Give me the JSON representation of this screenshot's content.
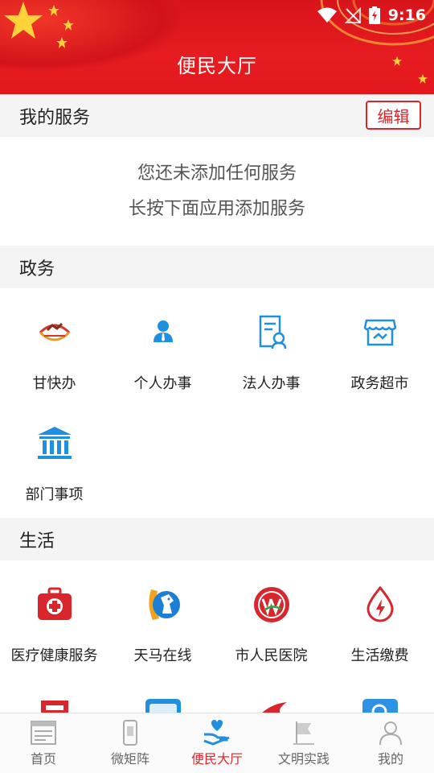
{
  "status_bar": {
    "time": "9:16",
    "icons": [
      "wifi-icon",
      "no-signal-icon",
      "battery-charging-icon"
    ]
  },
  "header": {
    "title": "便民大厅"
  },
  "my_services": {
    "title": "我的服务",
    "edit_label": "编辑",
    "empty_line1": "您还未添加任何服务",
    "empty_line2": "长按下面应用添加服务"
  },
  "government": {
    "title": "政务",
    "items": [
      {
        "label": "甘快办",
        "icon": "gankuaiban-logo-icon"
      },
      {
        "label": "个人办事",
        "icon": "person-icon"
      },
      {
        "label": "法人办事",
        "icon": "legal-person-document-icon"
      },
      {
        "label": "政务超市",
        "icon": "store-icon"
      },
      {
        "label": "部门事项",
        "icon": "government-building-icon"
      }
    ]
  },
  "life": {
    "title": "生活",
    "items": [
      {
        "label": "医疗健康服务",
        "icon": "medical-kit-icon"
      },
      {
        "label": "天马在线",
        "icon": "tianma-horse-icon"
      },
      {
        "label": "市人民医院",
        "icon": "hospital-logo-icon"
      },
      {
        "label": "生活缴费",
        "icon": "bill-payment-icon"
      }
    ]
  },
  "nav": {
    "items": [
      {
        "label": "首页",
        "icon": "news-icon"
      },
      {
        "label": "微矩阵",
        "icon": "phone-icon"
      },
      {
        "label": "便民大厅",
        "icon": "hand-heart-icon"
      },
      {
        "label": "文明实践",
        "icon": "flag-icon"
      },
      {
        "label": "我的",
        "icon": "user-icon"
      }
    ],
    "active_index": 2
  },
  "colors": {
    "brand_red": "#e0262c",
    "header_red": "#e61c20",
    "icon_blue": "#1f8fe0"
  }
}
